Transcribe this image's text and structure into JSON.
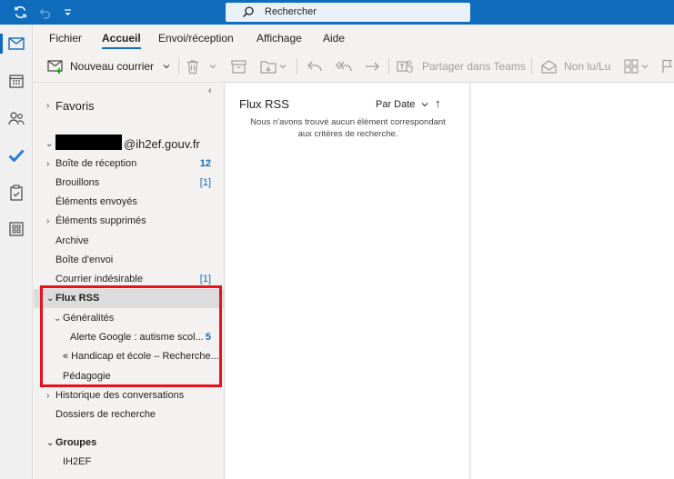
{
  "search": {
    "placeholder": "Rechercher"
  },
  "ribbon": {
    "tabs": [
      {
        "label": "Fichier"
      },
      {
        "label": "Accueil"
      },
      {
        "label": "Envoi/réception"
      },
      {
        "label": "Affichage"
      },
      {
        "label": "Aide"
      }
    ],
    "new_mail_label": "Nouveau courrier",
    "share_teams_label": "Partager dans Teams",
    "read_unread_label": "Non lu/Lu"
  },
  "folders": {
    "favorites_label": "Favoris",
    "account_suffix": "@ih2ef.gouv.fr",
    "items": [
      {
        "label": "Boîte de réception",
        "count": "12"
      },
      {
        "label": "Brouillons",
        "count": "[1]"
      },
      {
        "label": "Éléments envoyés",
        "count": ""
      },
      {
        "label": "Éléments supprimés",
        "count": ""
      },
      {
        "label": "Archive",
        "count": ""
      },
      {
        "label": "Boîte d'envoi",
        "count": ""
      },
      {
        "label": "Courrier indésirable",
        "count": "[1]"
      },
      {
        "label": "Flux RSS",
        "count": ""
      },
      {
        "label": "Généralités",
        "count": ""
      },
      {
        "label": "Alerte Google : autisme scol...",
        "count": "5"
      },
      {
        "label": "« Handicap et école – Recherche...",
        "count": ""
      },
      {
        "label": "Pédagogie",
        "count": ""
      },
      {
        "label": "Historique des conversations",
        "count": ""
      },
      {
        "label": "Dossiers de recherche",
        "count": ""
      }
    ],
    "groups_label": "Groupes",
    "group_item": "IH2EF"
  },
  "message_list": {
    "title": "Flux RSS",
    "sort_label": "Par Date",
    "sort_direction": "↑",
    "empty_line1": "Nous n'avons trouvé aucun élément correspondant",
    "empty_line2": "aux critères de recherche."
  },
  "colors": {
    "accent": "#0f6cbd",
    "highlight_box": "#e8121b"
  }
}
